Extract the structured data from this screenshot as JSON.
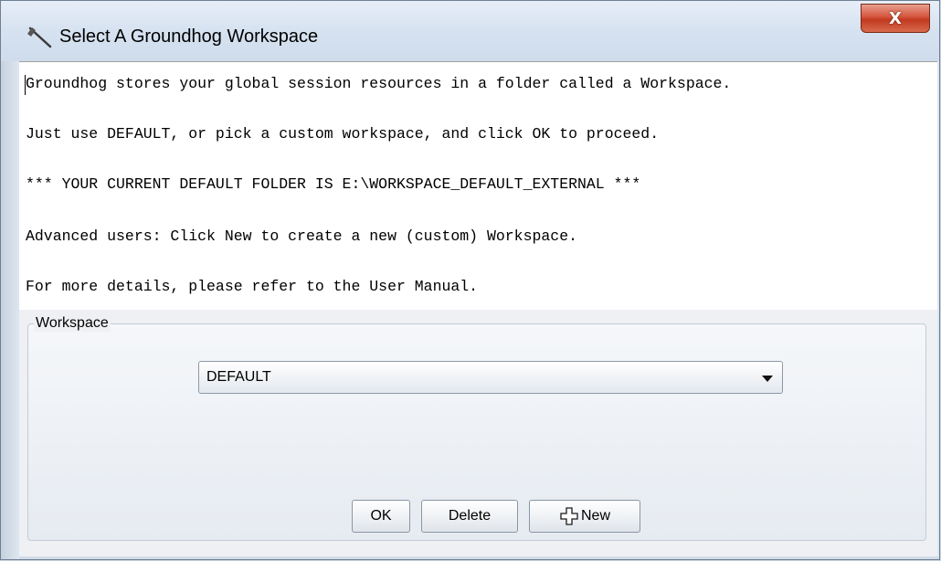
{
  "window": {
    "title": "Select A Groundhog Workspace",
    "title_icon": "hammer-icon",
    "close_label": "X"
  },
  "message": {
    "lines": [
      "Groundhog stores your global session resources in a folder called a Workspace.",
      "Just use DEFAULT, or pick a custom workspace, and click OK to proceed.",
      "*** YOUR CURRENT DEFAULT FOLDER IS E:\\WORKSPACE_DEFAULT_EXTERNAL ***",
      "Advanced users: Click New to create a new (custom) Workspace.",
      "For more details, please refer to the User Manual."
    ]
  },
  "workspace": {
    "group_label": "Workspace",
    "selected_value": "DEFAULT"
  },
  "buttons": {
    "ok_label": "OK",
    "delete_label": "Delete",
    "new_label": "New",
    "new_icon": "plus-outline-icon"
  },
  "colors": {
    "close_button": "#c84a2e",
    "window_frame": "#dfe8f2"
  }
}
